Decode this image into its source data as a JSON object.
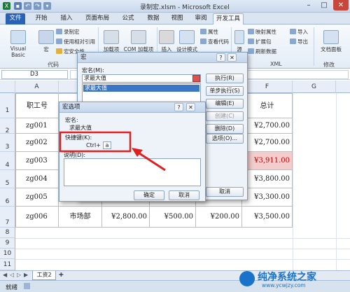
{
  "window": {
    "title": "录制宏.xlsm - Microsoft Excel",
    "minimize": "–",
    "restore": "□",
    "close": "✕"
  },
  "tabs": [
    "文件",
    "开始",
    "插入",
    "页面布局",
    "公式",
    "数据",
    "视图",
    "审阅",
    "开发工具"
  ],
  "ribbon": {
    "code": {
      "visual_basic": "Visual Basic",
      "macros": "宏",
      "record_macro": "录制宏",
      "relative_ref": "使用相对引用",
      "macro_security": "宏安全性",
      "group": "代码"
    },
    "addins": {
      "addins": "加载项",
      "com_addins": "COM 加载项"
    },
    "controls": {
      "insert": "插入",
      "design_mode": "设计模式",
      "properties": "属性",
      "view_code": "查看代码"
    },
    "xml": {
      "source": "源",
      "map_props": "映射属性",
      "expansion": "扩展包",
      "refresh": "刷新数据",
      "import": "导入",
      "export": "导出",
      "group": "XML"
    },
    "modify": {
      "doc_panel": "文档面板",
      "group": "修改"
    }
  },
  "formula_bar": {
    "name_box": "D3"
  },
  "columns": [
    "A",
    "B",
    "C",
    "D",
    "E",
    "F",
    "G"
  ],
  "rows": [
    "1",
    "2",
    "3",
    "4",
    "5",
    "6",
    "7",
    "8",
    "9",
    "10",
    "11"
  ],
  "table": {
    "header": {
      "a": "职工号",
      "b": "部",
      "f": "总计"
    },
    "rows": [
      {
        "a": "zg001",
        "b": "",
        "c": "",
        "d": "",
        "e": "",
        "f": "¥2,700.00"
      },
      {
        "a": "zg002",
        "b": "",
        "c": "",
        "d": "",
        "e": "",
        "f": "¥2,700.00"
      },
      {
        "a": "zg003",
        "b": "",
        "c": "",
        "d": "",
        "e": "",
        "f": "¥3,911.00"
      },
      {
        "a": "zg004",
        "b": "",
        "c": "",
        "d": "",
        "e": "",
        "f": "¥3,800.00"
      },
      {
        "a": "zg005",
        "b": "",
        "c": "",
        "d": "",
        "e": "",
        "f": "¥3,300.00"
      },
      {
        "a": "zg006",
        "b": "市场部",
        "c": "¥2,800.00",
        "d": "¥500.00",
        "e": "¥200.00",
        "f": "¥3,500.00"
      }
    ],
    "highlight_color": "#f4cccc",
    "highlight_text_color": "#c00000"
  },
  "sheet_tab": {
    "name": "工资2"
  },
  "status": {
    "ready": "就绪"
  },
  "macro_dialog": {
    "title": "宏",
    "help": "?",
    "close": "✕",
    "name_label": "宏名(M):",
    "name_value": "求最大值",
    "list_item": "求最大值",
    "buttons": {
      "run": "执行(R)",
      "step": "单步执行(S)",
      "edit": "编辑(E)",
      "create": "创建(C)",
      "delete": "删除(D)",
      "options": "选项(O)...",
      "cancel": "取消"
    }
  },
  "options_dialog": {
    "title": "宏选项",
    "help": "?",
    "close": "✕",
    "name_label": "宏名:",
    "name_value": "求最大值",
    "shortcut_label": "快捷键(K):",
    "ctrl_prefix": "Ctrl+",
    "shortcut_value": "a",
    "desc_label": "说明(D):",
    "ok": "确定",
    "cancel": "取消"
  },
  "watermark": {
    "title": "纯净系统之家",
    "url": "www.ycwjzy.com"
  },
  "colors": {
    "file_tab": "#2a63b5",
    "annotation_red": "#e02020",
    "watermark_blue": "#1a73c9"
  }
}
